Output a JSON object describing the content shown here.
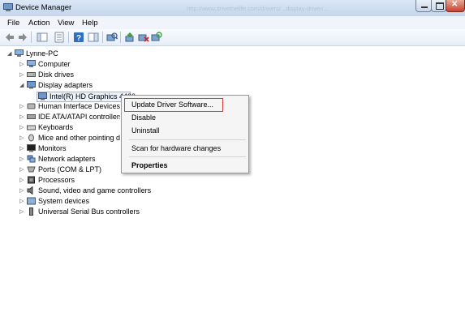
{
  "window": {
    "title": "Device Manager",
    "watermark": "http://www.drivethelife.com/drivers/...display-driver/..."
  },
  "menubar": {
    "items": [
      "File",
      "Action",
      "View",
      "Help"
    ]
  },
  "toolbar": {
    "buttons": [
      "back-icon",
      "forward-icon",
      "show-hide-tree-icon",
      "properties-icon",
      "help-icon",
      "action-pane-icon",
      "scan-hardware-icon",
      "update-driver-icon",
      "uninstall-icon",
      "enable-device-icon"
    ]
  },
  "tree": {
    "root": "Lynne-PC",
    "items": [
      {
        "label": "Computer",
        "expanded": false
      },
      {
        "label": "Disk drives",
        "expanded": false
      },
      {
        "label": "Display adapters",
        "expanded": true
      },
      {
        "label": "Intel(R) HD Graphics 4400",
        "child": true,
        "selected": true
      },
      {
        "label": "Human Interface Devices",
        "expanded": false
      },
      {
        "label": "IDE ATA/ATAPI controllers",
        "expanded": false
      },
      {
        "label": "Keyboards",
        "expanded": false
      },
      {
        "label": "Mice and other pointing devices",
        "expanded": false
      },
      {
        "label": "Monitors",
        "expanded": false
      },
      {
        "label": "Network adapters",
        "expanded": false
      },
      {
        "label": "Ports (COM & LPT)",
        "expanded": false
      },
      {
        "label": "Processors",
        "expanded": false
      },
      {
        "label": "Sound, video and game controllers",
        "expanded": false
      },
      {
        "label": "System devices",
        "expanded": false
      },
      {
        "label": "Universal Serial Bus controllers",
        "expanded": false
      }
    ]
  },
  "context_menu": {
    "update": "Update Driver Software...",
    "disable": "Disable",
    "uninstall": "Uninstall",
    "scan": "Scan for hardware changes",
    "properties": "Properties"
  },
  "colors": {
    "highlight_border": "#d23c3c",
    "selection": "#eaf2fb"
  }
}
